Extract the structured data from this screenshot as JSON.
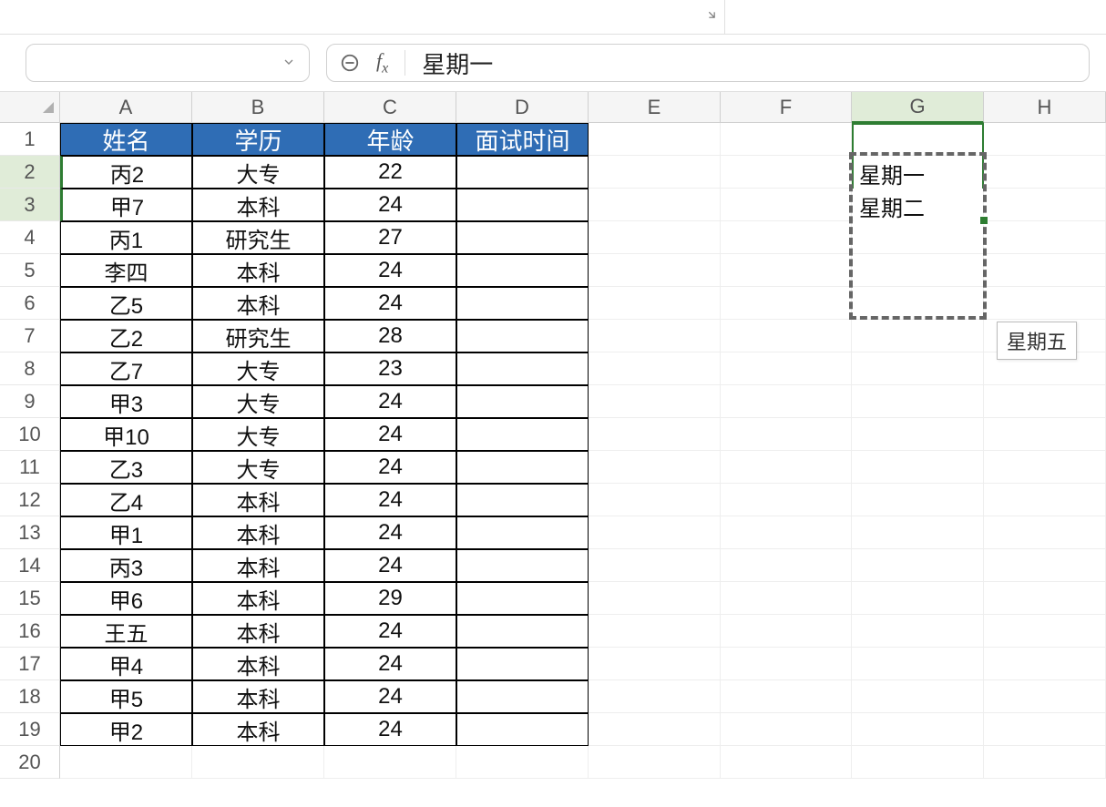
{
  "formulaBar": {
    "nameBox": "",
    "formula": "星期一"
  },
  "columns": [
    "A",
    "B",
    "C",
    "D",
    "E",
    "F",
    "G",
    "H"
  ],
  "rowCount": 20,
  "selectedRows": [
    2,
    3
  ],
  "selectedCol": "G",
  "table": {
    "headers": [
      "姓名",
      "学历",
      "年龄",
      "面试时间"
    ],
    "rows": [
      {
        "name": "丙2",
        "edu": "大专",
        "age": "22",
        "time": ""
      },
      {
        "name": "甲7",
        "edu": "本科",
        "age": "24",
        "time": ""
      },
      {
        "name": "丙1",
        "edu": "研究生",
        "age": "27",
        "time": ""
      },
      {
        "name": "李四",
        "edu": "本科",
        "age": "24",
        "time": ""
      },
      {
        "name": "乙5",
        "edu": "本科",
        "age": "24",
        "time": ""
      },
      {
        "name": "乙2",
        "edu": "研究生",
        "age": "28",
        "time": ""
      },
      {
        "name": "乙7",
        "edu": "大专",
        "age": "23",
        "time": ""
      },
      {
        "name": "甲3",
        "edu": "大专",
        "age": "24",
        "time": ""
      },
      {
        "name": "甲10",
        "edu": "大专",
        "age": "24",
        "time": ""
      },
      {
        "name": "乙3",
        "edu": "大专",
        "age": "24",
        "time": ""
      },
      {
        "name": "乙4",
        "edu": "本科",
        "age": "24",
        "time": ""
      },
      {
        "name": "甲1",
        "edu": "本科",
        "age": "24",
        "time": ""
      },
      {
        "name": "丙3",
        "edu": "本科",
        "age": "24",
        "time": ""
      },
      {
        "name": "甲6",
        "edu": "本科",
        "age": "29",
        "time": ""
      },
      {
        "name": "王五",
        "edu": "本科",
        "age": "24",
        "time": ""
      },
      {
        "name": "甲4",
        "edu": "本科",
        "age": "24",
        "time": ""
      },
      {
        "name": "甲5",
        "edu": "本科",
        "age": "24",
        "time": ""
      },
      {
        "name": "甲2",
        "edu": "本科",
        "age": "24",
        "time": ""
      }
    ]
  },
  "gCells": {
    "g2": "星期一",
    "g3": "星期二"
  },
  "tooltip": "星期五"
}
